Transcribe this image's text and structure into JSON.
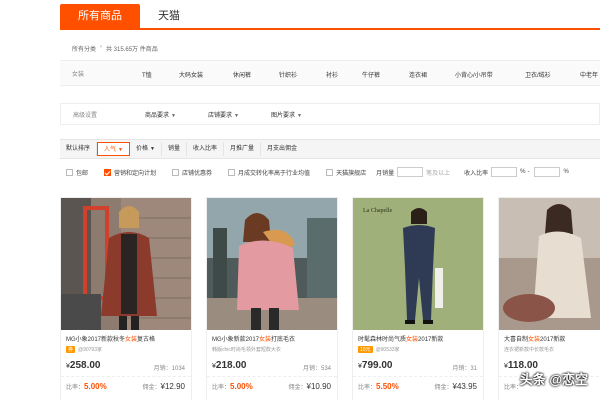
{
  "tabs": [
    {
      "label": "所有商品",
      "active": true
    },
    {
      "label": "天猫",
      "active": false
    }
  ],
  "breadcrumb": {
    "root": "所有分类",
    "sep": "›",
    "count": "共 315.65万 件商品"
  },
  "category": {
    "label": "女装",
    "items": [
      "T恤",
      "大码女装",
      "休闲裤",
      "针织衫",
      "衬衫",
      "牛仔裤",
      "连衣裙",
      "小背心/小吊带",
      "卫衣/绒衫",
      "中老年"
    ]
  },
  "advanced": {
    "label": "高级设置",
    "dropdowns": [
      "商品要求",
      "店铺要求",
      "图片要求"
    ]
  },
  "sort": [
    "默认排序",
    "人气",
    "价格",
    "销量",
    "收入比率",
    "月推广量",
    "月支出佣金"
  ],
  "filters": {
    "checks": [
      {
        "label": "包邮",
        "checked": false
      },
      {
        "label": "营销和定向计划",
        "checked": true
      },
      {
        "label": "店铺优惠券",
        "checked": false
      },
      {
        "label": "月成交转化率高于行业均值",
        "checked": false
      },
      {
        "label": "天猫旗舰店",
        "checked": false
      }
    ],
    "sales_label": "月销量",
    "sales_suffix": "笔及以上",
    "rate_label": "收入比率",
    "pct1": "%",
    "pct2": "%"
  },
  "products": [
    {
      "title_pre": "MG小象2017新款秋冬",
      "title_hl": "女装",
      "title_post": "复古格",
      "badge": "",
      "seller": "",
      "price": "258.00",
      "sold": "月销：1034",
      "rate": "5.00",
      "comm": "12.90"
    },
    {
      "title_pre": "MG小象新款2017",
      "title_hl": "女装",
      "title_post": "打底毛衣",
      "badge": "",
      "seller": "",
      "price": "218.00",
      "sold": "月销：534",
      "rate": "5.00",
      "comm": "10.90"
    },
    {
      "title_pre": "时髦森林时尚气质",
      "title_hl": "女装",
      "title_post": "2017新款",
      "badge": "10元",
      "seller": "@90533家",
      "price": "799.00",
      "sold": "月销：31",
      "rate": "5.50",
      "comm": "43.95"
    },
    {
      "title_pre": "大喜自制",
      "title_hl": "女装",
      "title_post": "2017新款",
      "badge": "",
      "seller": "",
      "price": "118.00",
      "sold": "",
      "rate": "",
      "comm": ""
    }
  ],
  "labels": {
    "yen": "¥",
    "rate": "比率：",
    "comm": "佣金：",
    "pct": "%"
  },
  "watermark": "头条 @恋空"
}
